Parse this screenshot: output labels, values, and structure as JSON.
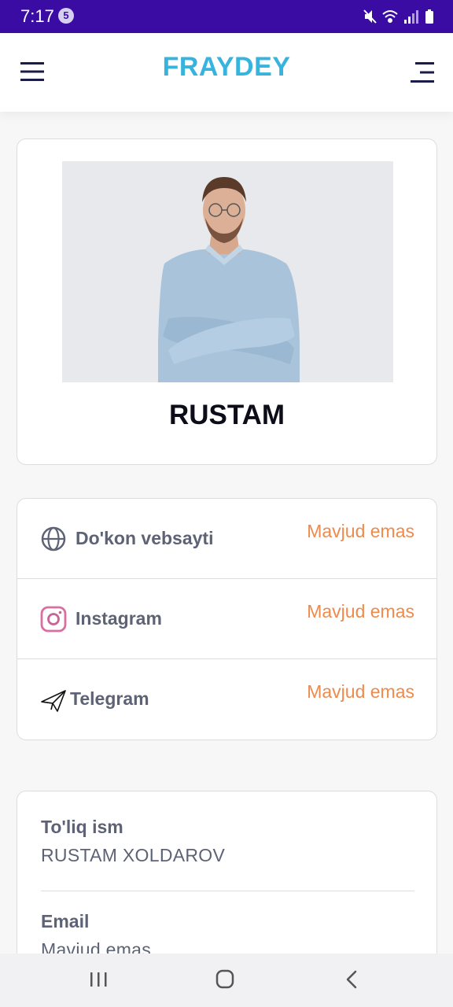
{
  "status_bar": {
    "time": "7:17",
    "notification_count": "5",
    "icons": [
      "mute-icon",
      "wifi-icon",
      "signal-icon",
      "battery-icon"
    ]
  },
  "header": {
    "brand": "FRAYDEY",
    "left_icon": "menu-icon",
    "right_icon": "menu-alt-icon"
  },
  "profile": {
    "name": "RUSTAM"
  },
  "links": [
    {
      "icon": "globe-icon",
      "label": "Do'kon vebsayti",
      "status": "Mavjud emas"
    },
    {
      "icon": "instagram-icon",
      "label": "Instagram",
      "status": "Mavjud emas"
    },
    {
      "icon": "telegram-icon",
      "label": "Telegram",
      "status": "Mavjud emas"
    }
  ],
  "info": {
    "full_name_label": "To'liq ism",
    "full_name_value": "RUSTAM XOLDAROV",
    "email_label": "Email",
    "email_value": "Mavjud emas"
  },
  "nav": {
    "icons": [
      "recent-apps-icon",
      "home-icon",
      "back-icon"
    ]
  },
  "colors": {
    "status_bar": "#3a0ca3",
    "brand": "#37b4dd",
    "status_text": "#ee8a4c",
    "label_text": "#5d6375"
  }
}
